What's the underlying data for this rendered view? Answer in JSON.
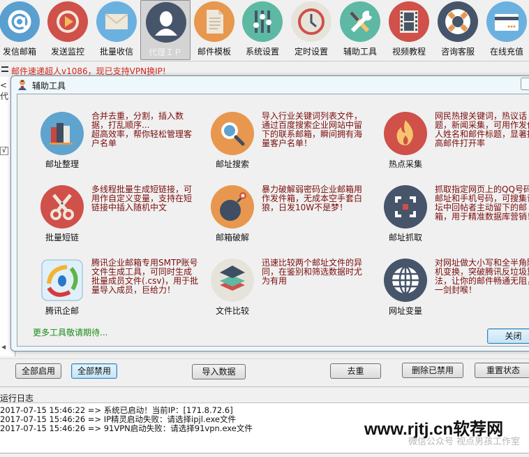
{
  "toolbar": {
    "items": [
      {
        "label": "发信邮箱",
        "icon": "at-sign-icon",
        "color": "#5a9fd0"
      },
      {
        "label": "发送监控",
        "icon": "play-icon",
        "color": "#d0504a"
      },
      {
        "label": "批量收信",
        "icon": "envelope-icon",
        "color": "#6bb1e0"
      },
      {
        "label": "代理ＩＰ",
        "icon": "user-silhouette-icon",
        "color": "#46556a",
        "active": true
      },
      {
        "label": "邮件模板",
        "icon": "document-icon",
        "color": "#e8974e"
      },
      {
        "label": "系统设置",
        "icon": "sliders-icon",
        "color": "#5db9a3"
      },
      {
        "label": "定时设置",
        "icon": "clock-icon",
        "color": "#e6e4da"
      },
      {
        "label": "辅助工具",
        "icon": "wrench-screwdriver-icon",
        "color": "#5db9a3"
      },
      {
        "label": "视频教程",
        "icon": "film-icon",
        "color": "#d0504a"
      },
      {
        "label": "咨询客服",
        "icon": "lifebuoy-icon",
        "color": "#46556a"
      },
      {
        "label": "在线充值",
        "icon": "credit-card-icon",
        "color": "#6bb1e0"
      }
    ]
  },
  "notice": "邮件速递超人v1086，现已支持VPN换IP!",
  "background_left": {
    "partial_text": "< 代",
    "check": "√"
  },
  "dialog": {
    "title": "辅助工具",
    "tools": [
      {
        "name": "邮址整理",
        "icon": "books-icon",
        "desc": "合并去重，分割，插入数据，打乱顺序...\n超高效率，帮你轻松管理客户名单"
      },
      {
        "name": "邮址搜索",
        "icon": "magnifier-icon",
        "desc": "导入行业关键词列表文件，通过百度搜索企业网站中留下的联系邮箱，瞬间拥有海量客户名单！"
      },
      {
        "name": "热点采集",
        "icon": "flame-icon",
        "desc": "网民热搜关键词，热议话题，新闻采集，可用作发件人姓名和邮件标题，显著提高邮件打开率"
      },
      {
        "name": "批量短链",
        "icon": "scissors-icon",
        "desc": "多线程批量生成短链接，可用作自定义变量，支持在短链接中插入随机中文"
      },
      {
        "name": "邮箱破解",
        "icon": "bomb-icon",
        "desc": "暴力破解弱密码企业邮箱用作发件箱，无成本空手套白狼，日发10W不是梦！"
      },
      {
        "name": "邮址抓取",
        "icon": "capture-frame-icon",
        "desc": "抓取指定网页上的QQ号码，邮址和手机号码，可搜集论坛中回帖者主动留下的邮箱，用于精准数据库营销！"
      },
      {
        "name": "腾讯企邮",
        "icon": "tencent-qq-icon",
        "desc": "腾讯企业邮箱专用SMTP账号文件生成工具，可同时生成批量成员文件(.csv)，用于批量导入成员，巨给力！"
      },
      {
        "name": "文件比较",
        "icon": "layers-icon",
        "desc": "迅速比较两个邮址文件的异同，在鉴别和筛选数据时尤为有用"
      },
      {
        "name": "网址变量",
        "icon": "globe-icon",
        "desc": "对网址做大小写和全半角随机变换，突破腾讯反垃圾算法，让你的邮件畅通无阻，一剑封喉！"
      }
    ],
    "more_text": "更多工具敬请期待...",
    "close_label": "关闭"
  },
  "buttons": {
    "enable_all": "全部启用",
    "disable_all": "全部禁用",
    "import_data": "导入数据",
    "dedupe": "去重",
    "delete_disabled": "删除已禁用",
    "reset_status": "重置状态"
  },
  "log": {
    "title": "运行日志",
    "lines": [
      "2017-07-15 15:46:22 => 系统已启动！当前IP：[171.8.72.6]",
      "2017-07-15 15:46:26 => IP精灵启动失败：请选择ipjl.exe文件",
      "2017-07-15 15:46:26 => 91VPN启动失败：请选择91vpn.exe文件"
    ]
  },
  "watermark": {
    "main": "www.rjtj.cn软荐网",
    "sub": "微信公众号 视点男孩工作室"
  }
}
